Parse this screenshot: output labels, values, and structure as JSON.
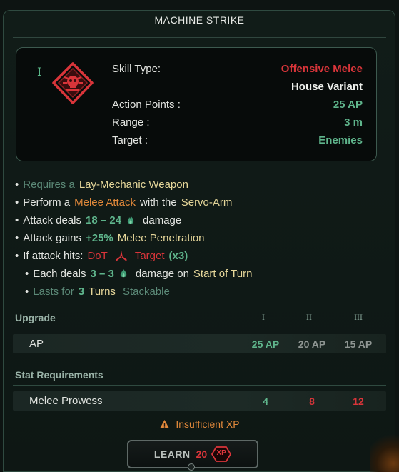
{
  "title": "MACHINE STRIKE",
  "tier_numeral": "I",
  "icon": "mechanicus-skull-cog-icon",
  "stats": {
    "skill_type_label": "Skill Type:",
    "skill_type_value": "Offensive Melee",
    "variant": "House Variant",
    "ap_label": "Action Points :",
    "ap_value": "25 AP",
    "range_label": "Range :",
    "range_value": "3 m",
    "target_label": "Target :",
    "target_value": "Enemies"
  },
  "description": {
    "requires_prefix": "Requires a",
    "requires_weapon": "Lay-Mechanic Weapon",
    "perform_prefix": "Perform a",
    "perform_attack": "Melee Attack",
    "perform_with": "with the",
    "perform_tool": "Servo-Arm",
    "deals_prefix": "Attack deals",
    "deals_range": "18 – 24",
    "deals_suffix": "damage",
    "gains_prefix": "Attack gains",
    "gains_value": "+25%",
    "gains_suffix": "Melee Penetration",
    "hits_prefix": "If attack hits:",
    "hits_effect": "DoT",
    "hits_target": "Target",
    "hits_mult": "(x3)",
    "each_prefix": "Each deals",
    "each_range": "3 – 3",
    "each_mid": "damage on",
    "each_when": "Start of Turn",
    "lasts_prefix": "Lasts for",
    "lasts_value": "3",
    "lasts_unit": "Turns",
    "lasts_stack": "Stackable"
  },
  "upgrade": {
    "header": "Upgrade",
    "tiers": [
      "I",
      "II",
      "III"
    ],
    "row_label": "AP",
    "values": [
      "25 AP",
      "20 AP",
      "15 AP"
    ]
  },
  "requirements": {
    "header": "Stat Requirements",
    "row_label": "Melee Prowess",
    "values": [
      "4",
      "8",
      "12"
    ]
  },
  "warning": "Insufficient XP",
  "learn": {
    "label": "LEARN",
    "cost": "20",
    "currency": "XP"
  },
  "colors": {
    "red": "#d9353a",
    "green": "#5fb58c",
    "orange": "#e0883a",
    "yellow": "#e6d79a"
  }
}
